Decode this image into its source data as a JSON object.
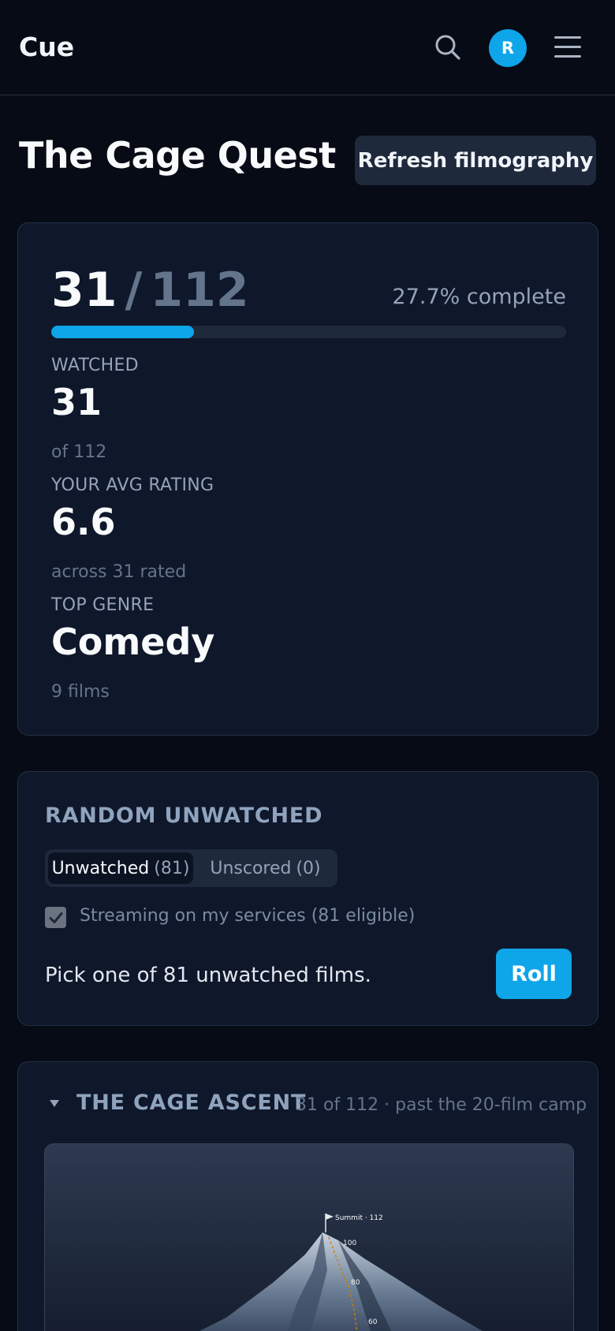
{
  "header": {
    "brand": "Cue",
    "avatar_initial": "R",
    "icons": {
      "search": "search-icon",
      "menu": "hamburger-menu-icon"
    }
  },
  "page": {
    "title": "The Cage Quest",
    "refresh_label": "Refresh filmography"
  },
  "progress": {
    "watched": "31",
    "separator": "/",
    "total": "112",
    "percent_text": "27.7% complete",
    "fraction": 0.277,
    "accent_color": "#0ea5e9",
    "stats": {
      "watched_label": "WATCHED",
      "watched_value": "31",
      "watched_sub": "of 112",
      "rating_label": "YOUR AVG RATING",
      "rating_value": "6.6",
      "rating_sub": "across 31 rated",
      "genre_label": "TOP GENRE",
      "genre_value": "Comedy",
      "genre_sub": "9 films"
    }
  },
  "random": {
    "title": "RANDOM UNWATCHED",
    "tabs": [
      {
        "label": "Unwatched",
        "count": "(81)",
        "active": true
      },
      {
        "label": "Unscored",
        "count": "(0)",
        "active": false
      }
    ],
    "streaming_label": "Streaming on my services (81 eligible)",
    "streaming_checked": true,
    "pick_text": "Pick one of 81 unwatched films.",
    "roll_label": "Roll"
  },
  "ascent": {
    "title": "THE CAGE ASCENT",
    "subtitle": "31 of 112 · past the 20-film camp",
    "summit_label": "Summit · 112",
    "markers": [
      "100",
      "80",
      "60"
    ]
  }
}
